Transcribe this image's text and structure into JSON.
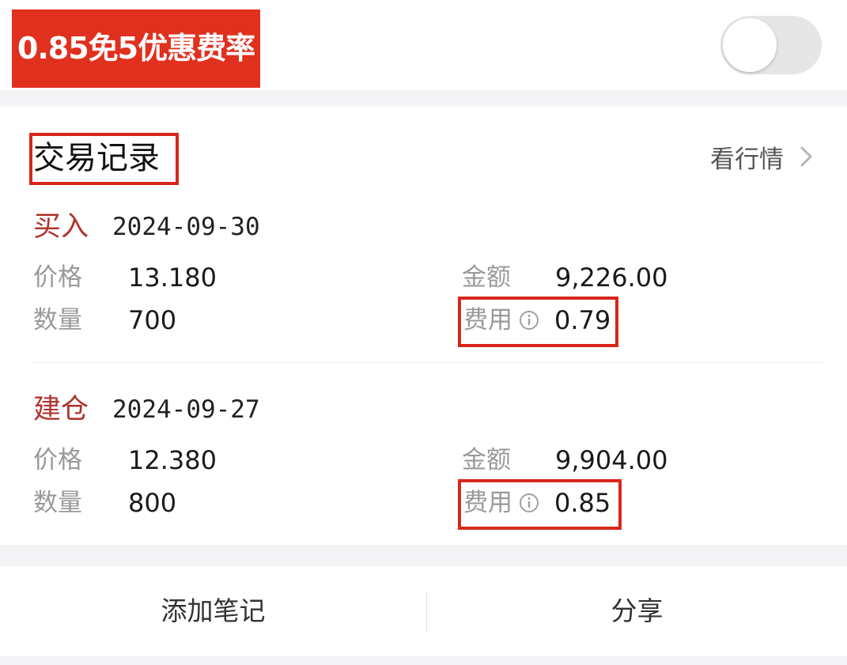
{
  "promo": {
    "banner_text": "0.85免5优惠费率",
    "toggle_on": false
  },
  "trade_section": {
    "title": "交易记录",
    "market_link_label": "看行情",
    "records": [
      {
        "type": "买入",
        "date": "2024-09-30",
        "price_label": "价格",
        "price": "13.180",
        "amount_label": "金额",
        "amount": "9,226.00",
        "quantity_label": "数量",
        "quantity": "700",
        "fee_label": "费用",
        "fee": "0.79"
      },
      {
        "type": "建仓",
        "date": "2024-09-27",
        "price_label": "价格",
        "price": "12.380",
        "amount_label": "金额",
        "amount": "9,904.00",
        "quantity_label": "数量",
        "quantity": "800",
        "fee_label": "费用",
        "fee": "0.85"
      }
    ]
  },
  "actions": {
    "add_note_label": "添加笔记",
    "share_label": "分享"
  },
  "colors": {
    "accent_red": "#e0301e",
    "highlight_border": "#d8261c",
    "record_type_text": "#b0342c",
    "muted_label": "#999999"
  },
  "icons": {
    "toggle": "toggle-switch",
    "chevron": "chevron-right-icon",
    "fee_info": "info-icon"
  }
}
